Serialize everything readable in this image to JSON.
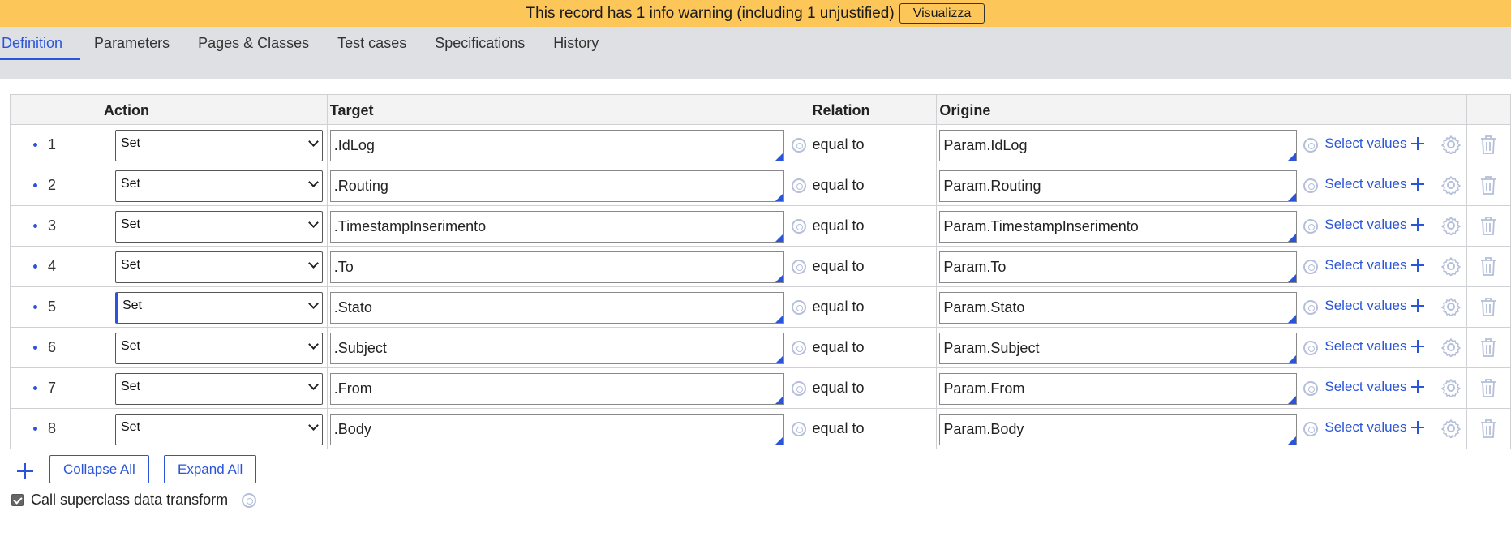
{
  "banner": {
    "message": "This record has 1 info warning (including 1 unjustified)",
    "button_label": "Visualizza"
  },
  "tabs": [
    {
      "label": "Definition",
      "active": true
    },
    {
      "label": "Parameters"
    },
    {
      "label": "Pages & Classes"
    },
    {
      "label": "Test cases"
    },
    {
      "label": "Specifications"
    },
    {
      "label": "History"
    }
  ],
  "grid": {
    "headers": {
      "action": "Action",
      "target": "Target",
      "relation": "Relation",
      "origin": "Origine"
    },
    "select_values_label": "Select values",
    "rows": [
      {
        "num": "1",
        "action": "Set",
        "target": ".IdLog",
        "relation": "equal to",
        "origin": "Param.IdLog"
      },
      {
        "num": "2",
        "action": "Set",
        "target": ".Routing",
        "relation": "equal to",
        "origin": "Param.Routing"
      },
      {
        "num": "3",
        "action": "Set",
        "target": ".TimestampInserimento",
        "relation": "equal to",
        "origin": "Param.TimestampInserimento"
      },
      {
        "num": "4",
        "action": "Set",
        "target": ".To",
        "relation": "equal to",
        "origin": "Param.To"
      },
      {
        "num": "5",
        "action": "Set",
        "target": ".Stato",
        "relation": "equal to",
        "origin": "Param.Stato"
      },
      {
        "num": "6",
        "action": "Set",
        "target": ".Subject",
        "relation": "equal to",
        "origin": "Param.Subject"
      },
      {
        "num": "7",
        "action": "Set",
        "target": ".From",
        "relation": "equal to",
        "origin": "Param.From"
      },
      {
        "num": "8",
        "action": "Set",
        "target": ".Body",
        "relation": "equal to",
        "origin": "Param.Body"
      }
    ]
  },
  "footer": {
    "collapse_all": "Collapse All",
    "expand_all": "Expand All",
    "superclass_label": "Call superclass data transform",
    "superclass_checked": true
  },
  "colors": {
    "accent": "#2a55d9",
    "banner": "#fcc659",
    "tabbar": "#dfe0e4"
  },
  "icons": [
    "add-row-icon",
    "target-icon",
    "gear-icon",
    "trash-icon",
    "plus-icon",
    "chevron-down-icon"
  ]
}
